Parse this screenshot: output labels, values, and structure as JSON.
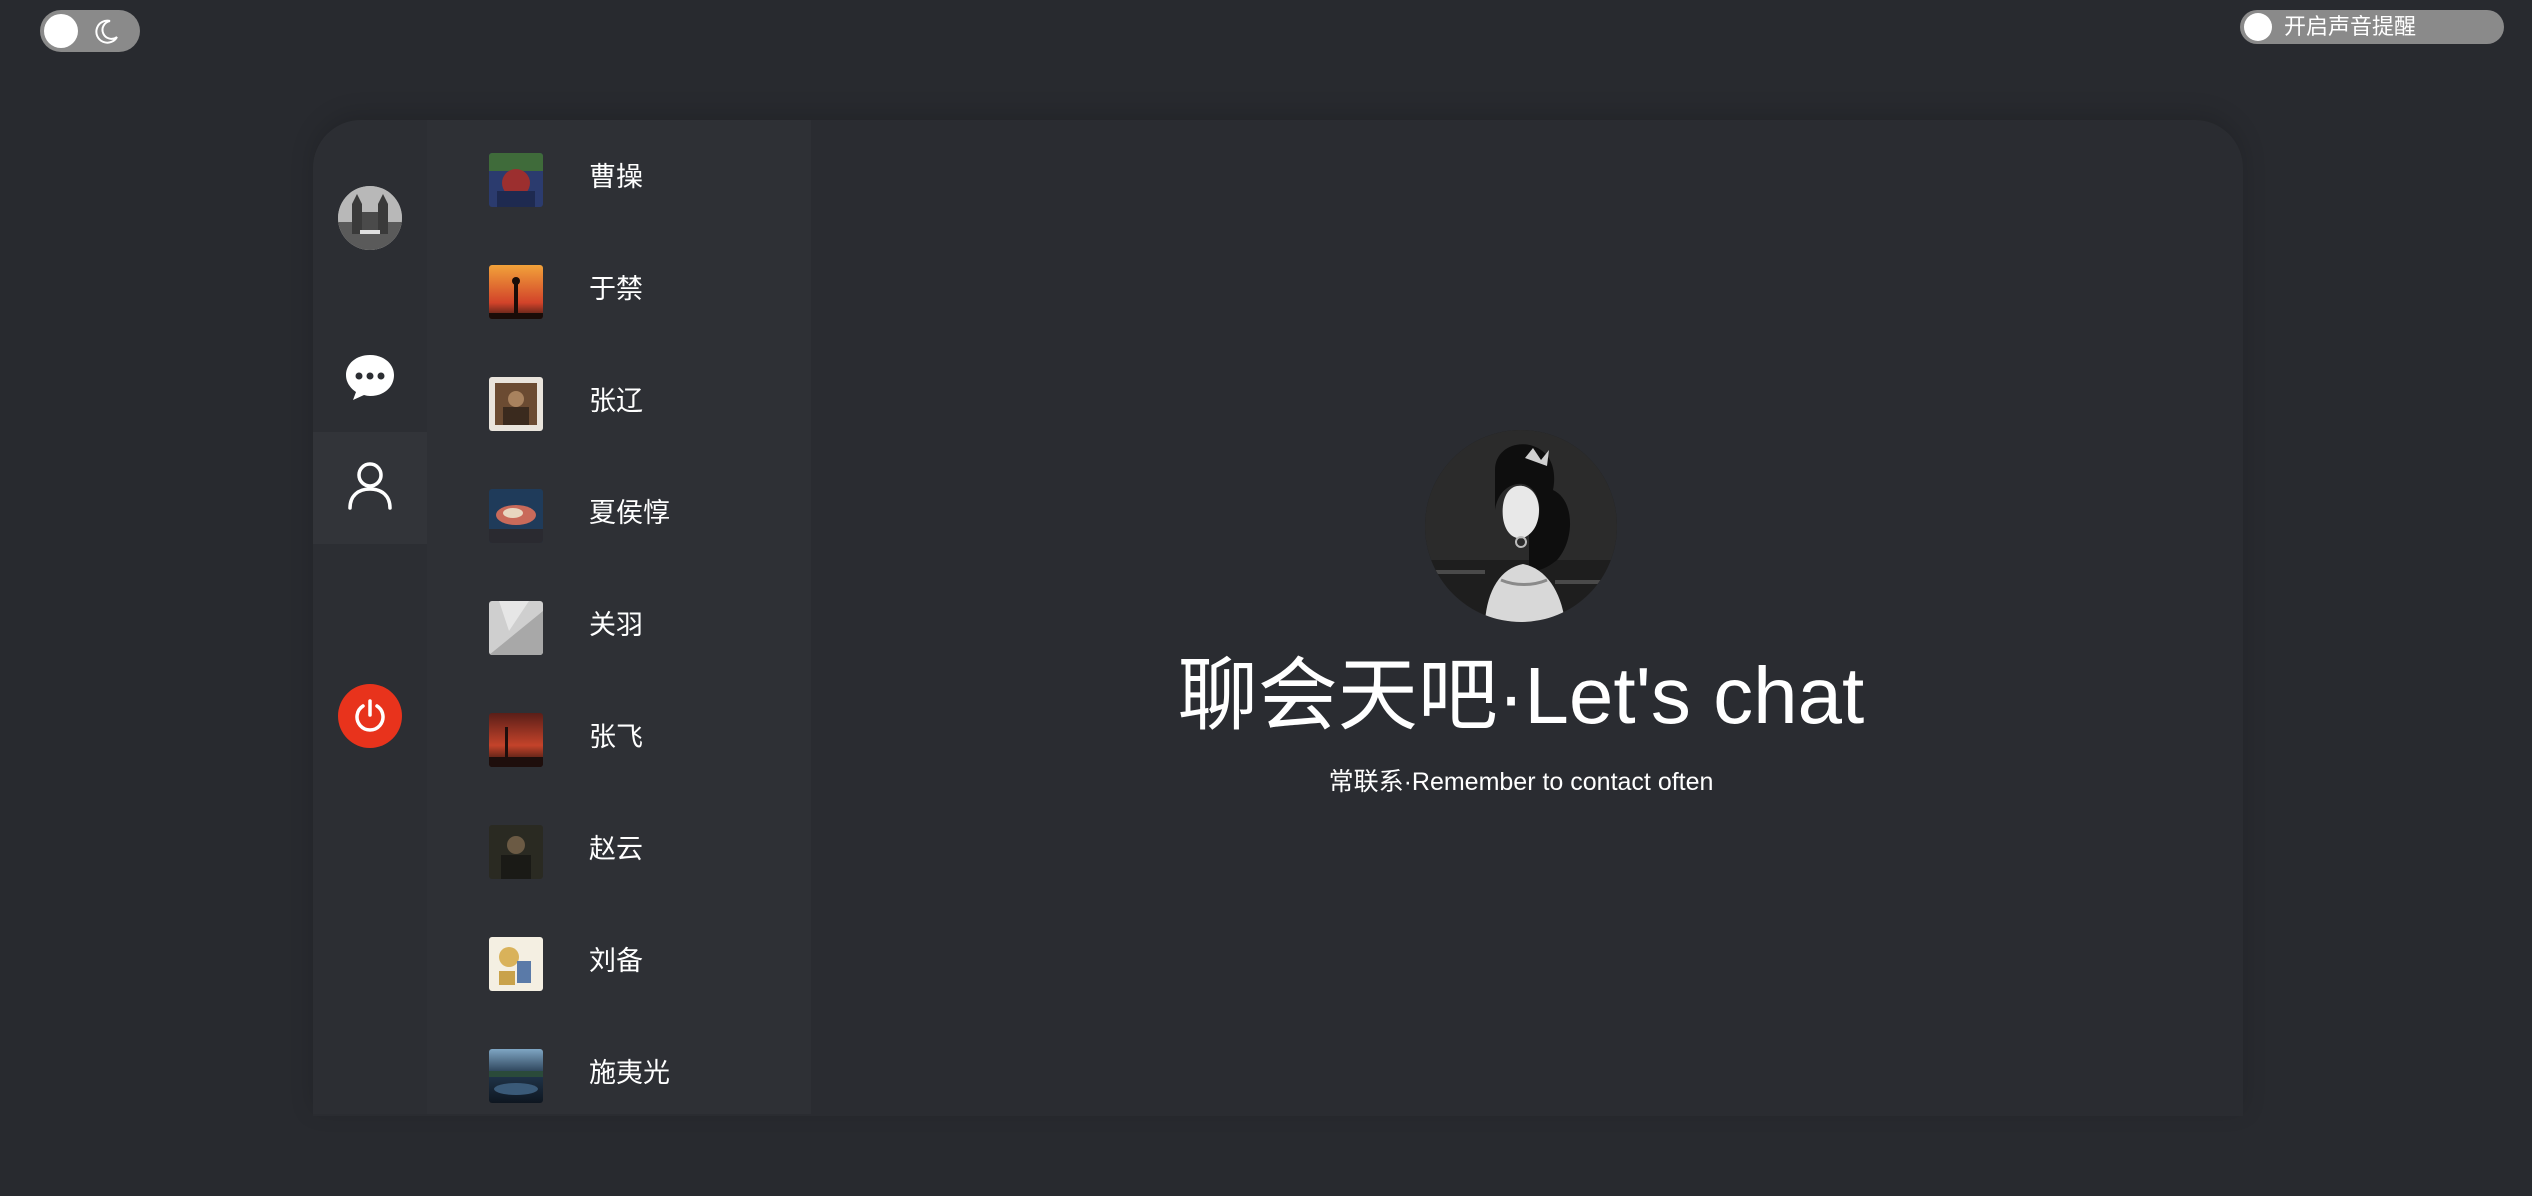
{
  "theme_toggle": {
    "icon": "moon-icon"
  },
  "sound_toggle": {
    "label": "开启声音提醒"
  },
  "sidebar": {
    "avatar_icon": "avatar",
    "items": [
      {
        "name": "chat",
        "icon": "chat-bubble-icon"
      },
      {
        "name": "contacts",
        "icon": "user-icon",
        "active": true
      }
    ],
    "power_icon": "power-icon",
    "power_color": "#e8331c"
  },
  "contacts": [
    {
      "name": "曹操",
      "colors": [
        "#2b3b6e",
        "#9c2f2f",
        "#3f6b3a"
      ]
    },
    {
      "name": "于禁",
      "colors": [
        "#f2a23a",
        "#d2432a",
        "#3a1a14"
      ]
    },
    {
      "name": "张辽",
      "colors": [
        "#e9e4dc",
        "#6b4b32",
        "#3a2a1e"
      ]
    },
    {
      "name": "夏侯惇",
      "colors": [
        "#1f3b5a",
        "#c96a5a",
        "#e8d6c0"
      ]
    },
    {
      "name": "关羽",
      "colors": [
        "#cfcfcf",
        "#a8a8a8",
        "#e6e6e6"
      ]
    },
    {
      "name": "张飞",
      "colors": [
        "#5a1e18",
        "#c4432a",
        "#1e0e0c"
      ]
    },
    {
      "name": "赵云",
      "colors": [
        "#2a2a22",
        "#6b5a44",
        "#1a1a16"
      ]
    },
    {
      "name": "刘备",
      "colors": [
        "#f4efe2",
        "#d9b25a",
        "#5a7aa8"
      ]
    },
    {
      "name": "施夷光",
      "colors": [
        "#7fa6c4",
        "#1f3348",
        "#0e1620"
      ]
    }
  ],
  "welcome": {
    "title": "聊会天吧·Let's chat",
    "subtitle": "常联系·Remember to contact often",
    "avatar_icon": "welcome-avatar"
  },
  "colors": {
    "background": "#282a2f",
    "panel": "#2a2c31",
    "toggle_track": "#8a8a8a",
    "accent_power": "#e8331c"
  }
}
